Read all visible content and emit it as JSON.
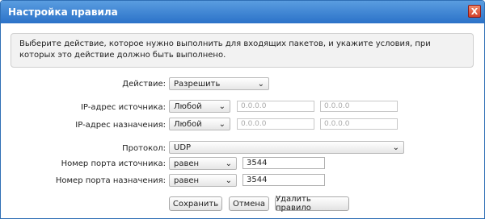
{
  "dialog": {
    "title": "Настройка правила",
    "close_label": "X"
  },
  "info_text": "Выберите действие, которое нужно выполнить для входящих пакетов, и укажите условия, при которых это действие должно быть выполнено.",
  "form": {
    "action": {
      "label": "Действие:",
      "value": "Разрешить"
    },
    "source_ip": {
      "label": "IP-адрес источника:",
      "mode": "Любой",
      "address_placeholder": "0.0.0.0",
      "mask_placeholder": "0.0.0.0"
    },
    "dest_ip": {
      "label": "IP-адрес назначения:",
      "mode": "Любой",
      "address_placeholder": "0.0.0.0",
      "mask_placeholder": "0.0.0.0"
    },
    "protocol": {
      "label": "Протокол:",
      "value": "UDP"
    },
    "source_port": {
      "label": "Номер порта источника:",
      "operator": "равен",
      "value": "3544"
    },
    "dest_port": {
      "label": "Номер порта назначения:",
      "operator": "равен",
      "value": "3544"
    }
  },
  "buttons": {
    "save": "Сохранить",
    "cancel": "Отмена",
    "delete": "Удалить правило"
  },
  "icons": {
    "dropdown": "chevron-down-icon",
    "close": "close-icon"
  },
  "colors": {
    "titlebar": "#2b72c8",
    "close": "#d2402a"
  }
}
